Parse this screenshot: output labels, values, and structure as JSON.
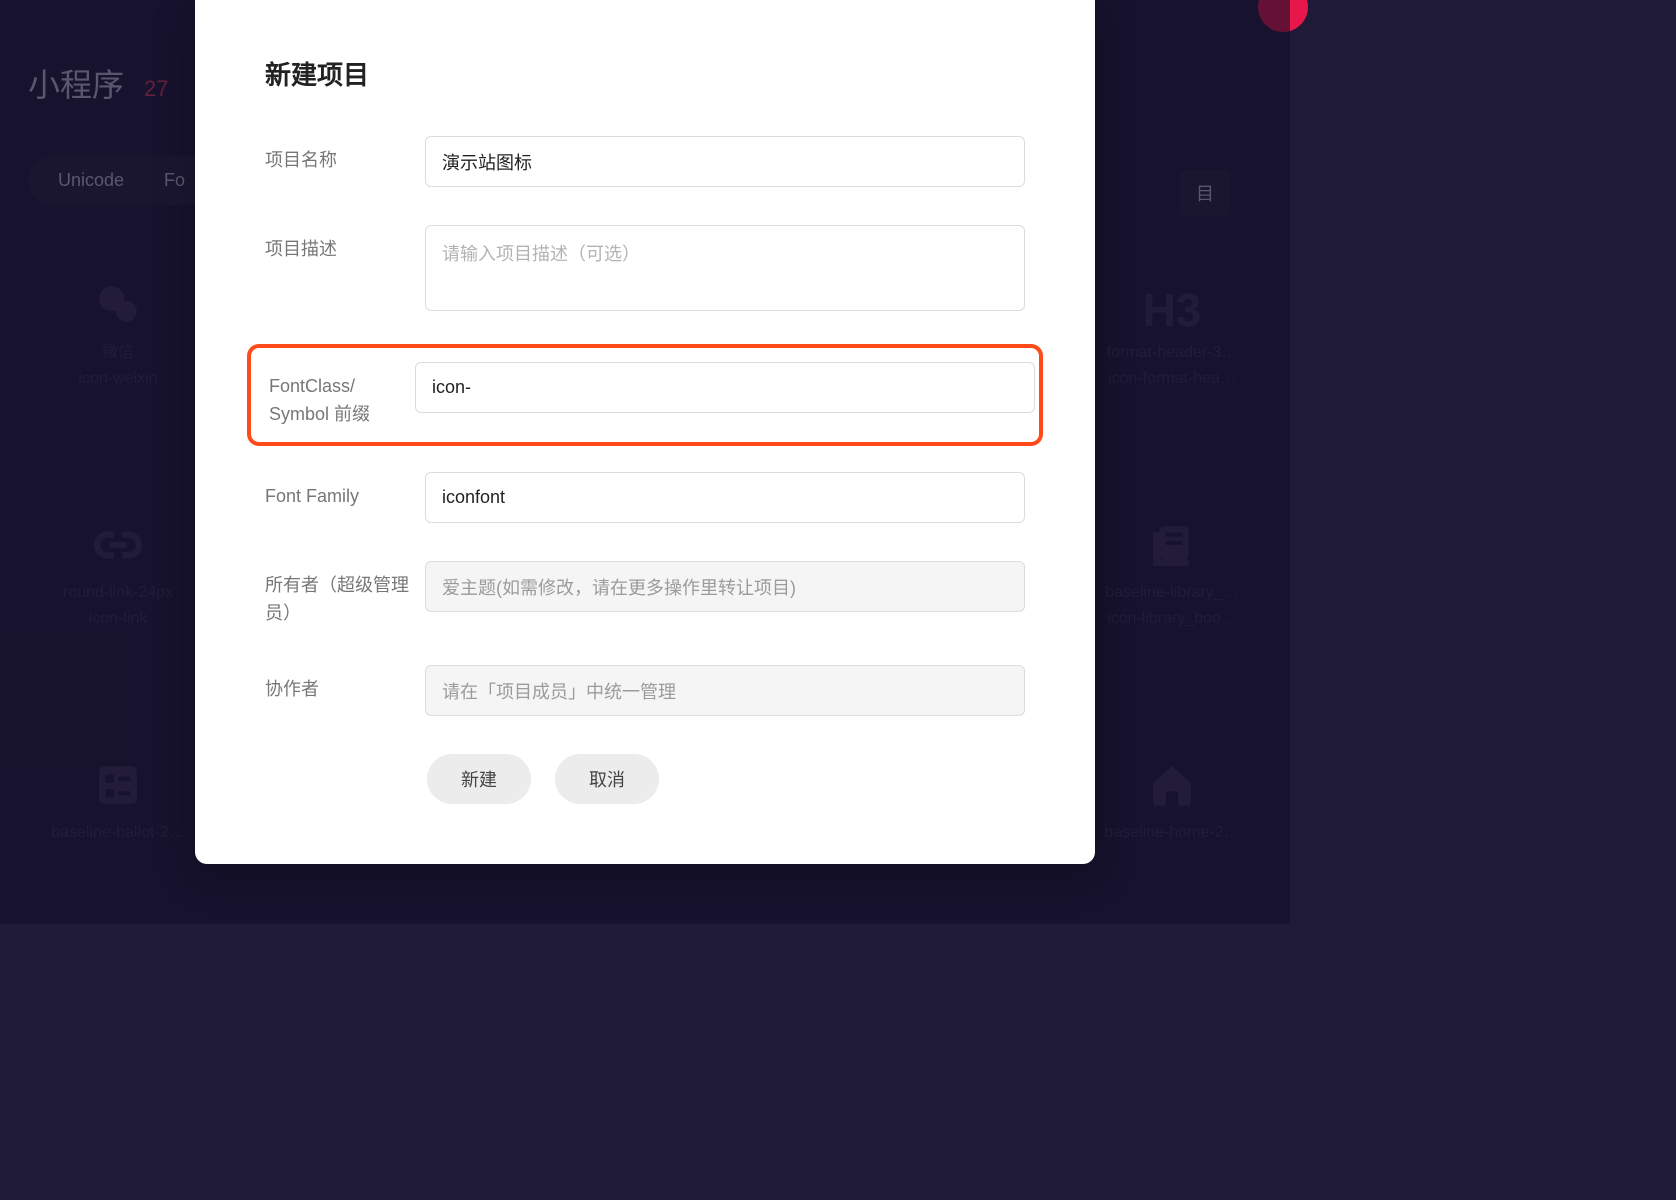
{
  "bg": {
    "title": "小程序",
    "count": "27",
    "tabs": [
      "Unicode",
      "Fo"
    ],
    "right_chip": "目",
    "icons": {
      "row1": [
        {
          "name": "微信",
          "slug": "icon-weixin",
          "glyph": "wechat"
        },
        {
          "name": "format-header-3…",
          "slug": "icon-format-hea…",
          "glyph": "h3"
        }
      ],
      "row2": [
        {
          "name": "round-link-24px",
          "slug": "icon-link",
          "glyph": "link"
        },
        {
          "name": "baseline-library_…",
          "slug": "icon-library_boo…",
          "glyph": "library"
        }
      ],
      "row3": [
        {
          "name": "baseline-ballot-2…",
          "slug": "",
          "glyph": "ballot"
        },
        {
          "name": "baseline-home-2…",
          "slug": "",
          "glyph": "home"
        }
      ]
    }
  },
  "modal": {
    "title": "新建项目",
    "fields": {
      "name": {
        "label": "项目名称",
        "value": "演示站图标"
      },
      "desc": {
        "label": "项目描述",
        "placeholder": "请输入项目描述（可选）"
      },
      "prefix": {
        "label": "FontClass/\nSymbol 前缀",
        "value": "icon-"
      },
      "family": {
        "label": "Font Family",
        "value": "iconfont"
      },
      "owner": {
        "label": "所有者（超级管理员）",
        "value": "爱主题(如需修改，请在更多操作里转让项目)"
      },
      "collaborator": {
        "label": "协作者",
        "value": "请在「项目成员」中统一管理"
      }
    },
    "actions": {
      "create": "新建",
      "cancel": "取消"
    }
  }
}
